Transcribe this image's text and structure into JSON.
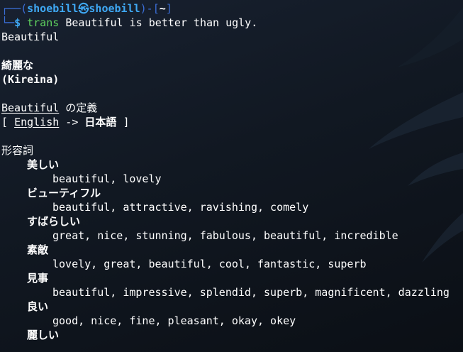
{
  "prompt": {
    "corner_top": "┌──(",
    "user": "shoebill",
    "at": "㉿",
    "host": "shoebill",
    "mid": ")-[",
    "cwd": "~",
    "end": "]",
    "corner_bottom": "└─",
    "dollar": "$",
    "command": "trans",
    "args": "Beautiful is better than ugly."
  },
  "output": {
    "source_word": "Beautiful",
    "translation": "綺麗な",
    "romanization": "(Kireina)",
    "definition_word": "Beautiful",
    "definition_suffix": " の定義",
    "lang_open": "[ ",
    "lang_from": "English",
    "lang_arrow": " -> ",
    "lang_to": "日本語",
    "lang_close": " ]",
    "pos": "形容詞",
    "entries": [
      {
        "word": "美しい",
        "synonyms": "beautiful, lovely"
      },
      {
        "word": "ビューティフル",
        "synonyms": "beautiful, attractive, ravishing, comely"
      },
      {
        "word": "すばらしい",
        "synonyms": "great, nice, stunning, fabulous, beautiful, incredible"
      },
      {
        "word": "素敵",
        "synonyms": "lovely, great, beautiful, cool, fantastic, superb"
      },
      {
        "word": "見事",
        "synonyms": "beautiful, impressive, splendid, superb, magnificent, dazzling"
      },
      {
        "word": "良い",
        "synonyms": "good, nice, fine, pleasant, okay, okey"
      },
      {
        "word": "麗しい",
        "synonyms": ""
      }
    ]
  },
  "colors": {
    "background": "#0f141c",
    "prompt_frame": "#3b6fd9",
    "prompt_user": "#3fa9f5",
    "command": "#5fd35f",
    "text": "#ffffff"
  }
}
